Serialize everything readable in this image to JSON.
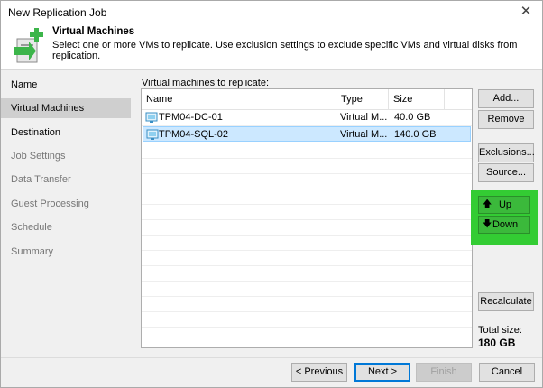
{
  "window": {
    "title": "New Replication Job",
    "close_symbol": "✕"
  },
  "header": {
    "title": "Virtual Machines",
    "description": "Select one or more VMs to replicate. Use exclusion settings to exclude specific VMs and virtual disks from replication.",
    "icon": "add-vm-icon"
  },
  "nav": {
    "items": [
      {
        "label": "Name",
        "state": "done"
      },
      {
        "label": "Virtual Machines",
        "state": "active"
      },
      {
        "label": "Destination",
        "state": "done"
      },
      {
        "label": "Job Settings",
        "state": "pending"
      },
      {
        "label": "Data Transfer",
        "state": "pending"
      },
      {
        "label": "Guest Processing",
        "state": "pending"
      },
      {
        "label": "Schedule",
        "state": "pending"
      },
      {
        "label": "Summary",
        "state": "pending"
      }
    ]
  },
  "vm_list": {
    "label": "Virtual machines to replicate:",
    "columns": [
      "Name",
      "Type",
      "Size"
    ],
    "rows": [
      {
        "name": "TPM04-DC-01",
        "type": "Virtual M...",
        "size": "40.0 GB",
        "selected": false,
        "icon": "vm-icon"
      },
      {
        "name": "TPM04-SQL-02",
        "type": "Virtual M...",
        "size": "140.0 GB",
        "selected": true,
        "icon": "vm-icon"
      }
    ]
  },
  "buttons": {
    "add": "Add...",
    "remove": "Remove",
    "exclusions": "Exclusions...",
    "source": "Source...",
    "up": "Up",
    "down": "Down",
    "recalculate": "Recalculate"
  },
  "totals": {
    "label": "Total size:",
    "value": "180 GB"
  },
  "footer": {
    "previous": "< Previous",
    "next": "Next >",
    "finish": "Finish",
    "cancel": "Cancel"
  },
  "colors": {
    "highlight": "#33cc33",
    "selection": "#cce8ff",
    "accent": "#0078d7"
  }
}
